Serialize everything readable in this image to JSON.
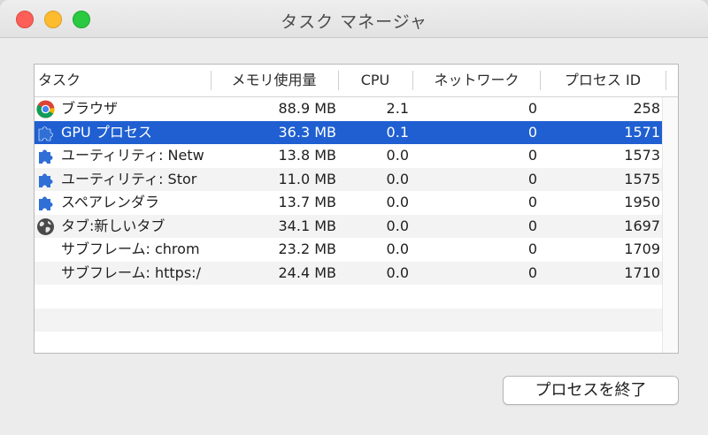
{
  "window": {
    "title": "タスク マネージャ"
  },
  "columns": {
    "task": "タスク",
    "memory": "メモリ使用量",
    "cpu": "CPU",
    "network": "ネットワーク",
    "pid": "プロセス ID"
  },
  "rows": [
    {
      "name": "ブラウザ",
      "memory": "88.9 MB",
      "cpu": "2.1",
      "network": "0",
      "pid": "258",
      "icon": "chrome-icon",
      "selected": false
    },
    {
      "name": "GPU プロセス",
      "memory": "36.3 MB",
      "cpu": "0.1",
      "network": "0",
      "pid": "1571",
      "icon": "puzzle-icon",
      "selected": true
    },
    {
      "name": "ユーティリティ: Netw",
      "memory": "13.8 MB",
      "cpu": "0.0",
      "network": "0",
      "pid": "1573",
      "icon": "puzzle-icon",
      "selected": false
    },
    {
      "name": "ユーティリティ: Stor",
      "memory": "11.0 MB",
      "cpu": "0.0",
      "network": "0",
      "pid": "1575",
      "icon": "puzzle-icon",
      "selected": false
    },
    {
      "name": "スペアレンダラ",
      "memory": "13.7 MB",
      "cpu": "0.0",
      "network": "0",
      "pid": "1950",
      "icon": "puzzle-icon",
      "selected": false
    },
    {
      "name": "タブ:新しいタブ",
      "memory": "34.1 MB",
      "cpu": "0.0",
      "network": "0",
      "pid": "1697",
      "icon": "globe-icon",
      "selected": false
    },
    {
      "name": "サブフレーム: chrom",
      "memory": "23.2 MB",
      "cpu": "0.0",
      "network": "0",
      "pid": "1709",
      "icon": "",
      "selected": false
    },
    {
      "name": "サブフレーム: https:/",
      "memory": "24.4 MB",
      "cpu": "0.0",
      "network": "0",
      "pid": "1710",
      "icon": "",
      "selected": false
    }
  ],
  "buttons": {
    "end_process": "プロセスを終了"
  },
  "colors": {
    "selection": "#1f5fd1",
    "puzzle_icon": "#2f6fd6"
  }
}
